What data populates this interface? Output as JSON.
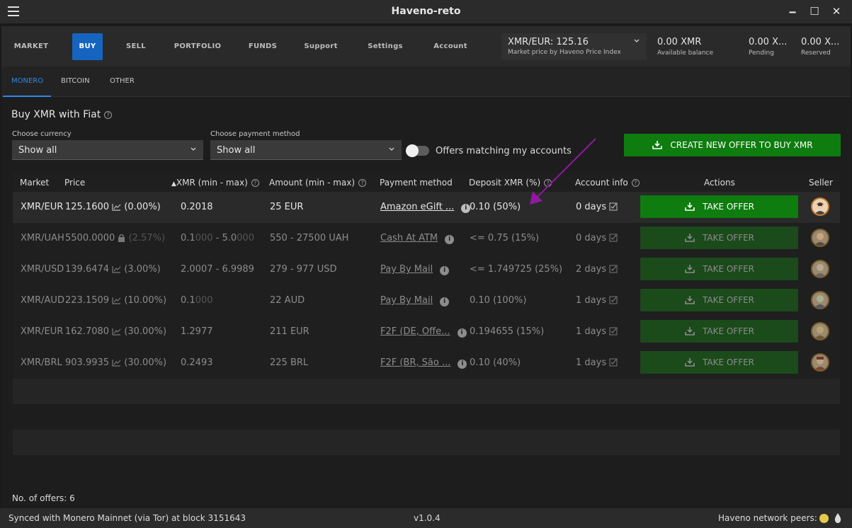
{
  "window": {
    "title": "Haveno-reto",
    "minimize": "🗕",
    "maximize": "☐",
    "close": "✕"
  },
  "nav": {
    "items": [
      "MARKET",
      "BUY",
      "SELL",
      "PORTFOLIO",
      "FUNDS",
      "Support",
      "Settings",
      "Account"
    ],
    "active": "BUY",
    "price": {
      "value": "XMR/EUR: 125.16",
      "label": "Market price by Haveno Price Index"
    },
    "balances": [
      {
        "value": "0.00 XMR",
        "label": "Available balance"
      },
      {
        "value": "0.00 X...",
        "label": "Pending"
      },
      {
        "value": "0.00 X...",
        "label": "Reserved"
      }
    ]
  },
  "subtabs": {
    "items": [
      "MONERO",
      "BITCOIN",
      "OTHER"
    ],
    "active": "MONERO"
  },
  "page": {
    "heading": "Buy XMR with Fiat",
    "currency": {
      "label": "Choose currency",
      "value": "Show all"
    },
    "payment": {
      "label": "Choose payment method",
      "value": "Show all"
    },
    "toggle_label": "Offers matching my accounts",
    "create_button": "CREATE NEW OFFER TO BUY XMR",
    "offer_count": "No. of offers: 6"
  },
  "table": {
    "headers": {
      "market": "Market",
      "price": "Price",
      "xmr": "XMR (min - max)",
      "amount": "Amount (min - max)",
      "payment": "Payment method",
      "deposit": "Deposit XMR (%)",
      "account": "Account info",
      "actions": "Actions",
      "seller": "Seller"
    },
    "take_label": "TAKE OFFER",
    "rows": [
      {
        "market": "XMR/EUR",
        "price": "125.1600",
        "pct": "(0.00%)",
        "xmr_a": "0.2018",
        "xmr_b": "",
        "amount": "25 EUR",
        "payment": "Amazon eGift ...",
        "deposit": "0.10 (50%)",
        "account": "0 days"
      },
      {
        "market": "XMR/UAH",
        "price": "5500.0000",
        "pct": "(2.57%)",
        "xmr_a": "0.1",
        "xmr_a_f": "000",
        "xmr_mid": " - 5.0",
        "xmr_b_f": "000",
        "amount": "550 - 27500 UAH",
        "payment": "Cash At ATM",
        "deposit": "<= 0.75 (15%)",
        "account": "0 days"
      },
      {
        "market": "XMR/USD",
        "price": "139.6474",
        "pct": "(3.00%)",
        "xmr_a": "2.0007 - 6.9989",
        "amount": "279 - 977 USD",
        "payment": "Pay By Mail",
        "deposit": "<= 1.749725 (25%)",
        "account": "2 days"
      },
      {
        "market": "XMR/AUD",
        "price": "223.1509",
        "pct": "(10.00%)",
        "xmr_a": "0.1",
        "xmr_a_f": "000",
        "amount": "22 AUD",
        "payment": "Pay By Mail",
        "deposit": "0.10 (100%)",
        "account": "1 days"
      },
      {
        "market": "XMR/EUR",
        "price": "162.7080",
        "pct": "(30.00%)",
        "xmr_a": "1.2977",
        "amount": "211 EUR",
        "payment": "F2F (DE, Offe...",
        "deposit": "0.194655 (15%)",
        "account": "1 days"
      },
      {
        "market": "XMR/BRL",
        "price": "903.9935",
        "pct": "(30.00%)",
        "xmr_a": "0.2493",
        "amount": "225 BRL",
        "payment": "F2F (BR, São ...",
        "deposit": "0.10 (40%)",
        "account": "1 days"
      }
    ]
  },
  "status": {
    "sync": "Synced with Monero Mainnet (via Tor) at block 3151643",
    "version": "v1.0.4",
    "peers": "Haveno network peers: 2"
  },
  "colors": {
    "accent": "#1565c0",
    "green": "#0e7c0e",
    "annotation": "#8e1a9e"
  }
}
